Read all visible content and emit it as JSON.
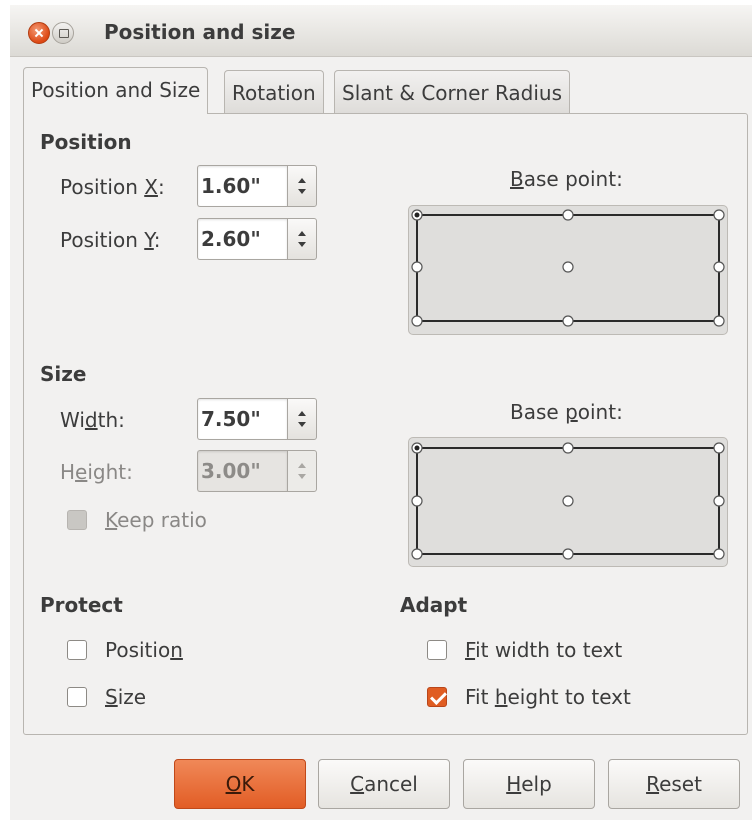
{
  "window": {
    "title": "Position and size"
  },
  "tabs": [
    {
      "label": "Position and Size",
      "active": true
    },
    {
      "label": "Rotation",
      "active": false
    },
    {
      "label": "Slant & Corner Radius",
      "active": false
    }
  ],
  "position": {
    "section_title": "Position",
    "x_label_prefix": "Position ",
    "x_label_mnemonic": "X",
    "x_label_suffix": ":",
    "x_value": "1.60\"",
    "y_label_prefix": "Position ",
    "y_label_mnemonic": "Y",
    "y_label_suffix": ":",
    "y_value": "2.60\"",
    "base_point_prefix": "",
    "base_point_mnemonic": "B",
    "base_point_suffix": "ase point:",
    "selected_base_point": "top-left"
  },
  "size": {
    "section_title": "Size",
    "width_prefix": "Wi",
    "width_mnemonic": "d",
    "width_suffix": "th:",
    "width_value": "7.50\"",
    "height_prefix": "H",
    "height_mnemonic": "e",
    "height_suffix": "ight:",
    "height_value": "3.00\"",
    "height_disabled": true,
    "keep_ratio_prefix": "",
    "keep_ratio_mnemonic": "K",
    "keep_ratio_suffix": "eep ratio",
    "keep_ratio_checked": false,
    "keep_ratio_disabled": true,
    "base_point_prefix": "Base ",
    "base_point_mnemonic": "p",
    "base_point_suffix": "oint:",
    "selected_base_point": "top-left"
  },
  "protect": {
    "section_title": "Protect",
    "position_prefix": "Positio",
    "position_mnemonic": "n",
    "position_suffix": "",
    "position_checked": false,
    "size_prefix": "",
    "size_mnemonic": "S",
    "size_suffix": "ize",
    "size_checked": false
  },
  "adapt": {
    "section_title": "Adapt",
    "fit_width_prefix": "",
    "fit_width_mnemonic": "F",
    "fit_width_suffix": "it width to text",
    "fit_width_checked": false,
    "fit_height_prefix": "Fit ",
    "fit_height_mnemonic": "h",
    "fit_height_suffix": "eight to text",
    "fit_height_checked": true
  },
  "buttons": {
    "ok_prefix": "",
    "ok_mnemonic": "O",
    "ok_suffix": "K",
    "cancel_prefix": "",
    "cancel_mnemonic": "C",
    "cancel_suffix": "ancel",
    "help_prefix": "",
    "help_mnemonic": "H",
    "help_suffix": "elp",
    "reset_prefix": "",
    "reset_mnemonic": "R",
    "reset_suffix": "eset"
  },
  "colors": {
    "accent": "#e05d22",
    "dialog_bg": "#f2f1f0"
  }
}
